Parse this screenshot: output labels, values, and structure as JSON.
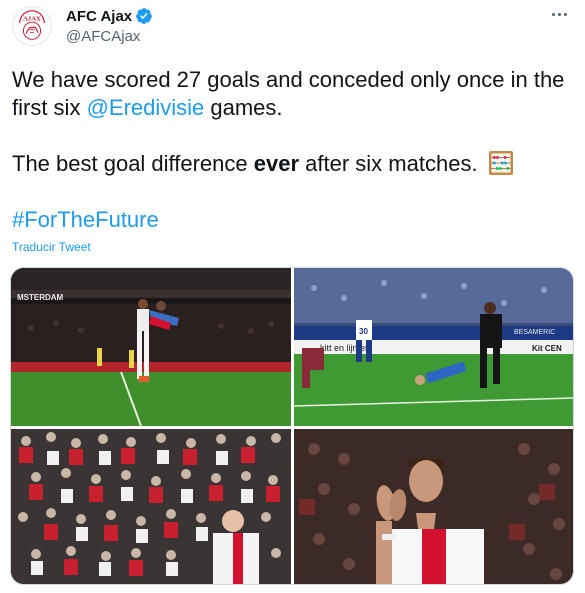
{
  "account": {
    "display_name": "AFC Ajax",
    "handle": "@AFCAjax",
    "avatar_icon": "ajax-crest-icon",
    "verified_icon": "verified-badge-icon",
    "verified_color": "#1d9bf0"
  },
  "tweet": {
    "line1_pre": "We have scored 27 goals and conceded only once in the first six ",
    "mention": "@Eredivisie",
    "line1_post": " games.",
    "line2_pre": "The best goal difference ",
    "line2_bold": "ever",
    "line2_post": " after six matches. ",
    "emoji_icon": "abacus-icon",
    "hashtag": "#ForTheFuture",
    "translate_label": "Traducir Tweet"
  },
  "media": {
    "photos": [
      {
        "icon": "photo-players-celebrating-icon"
      },
      {
        "icon": "photo-player-running-icon"
      },
      {
        "icon": "photo-crowd-icon"
      },
      {
        "icon": "photo-player-applauding-icon"
      }
    ],
    "stadium_banner_1": "MSTERDAM",
    "stadium_banner_2": "kitt  en lijmen",
    "stadium_banner_3": "Kit CEN",
    "stadium_banner_4": "BESAMERIC",
    "shirt_number": "30"
  },
  "colors": {
    "text": "#0f1419",
    "secondary": "#536471",
    "link": "#1d9bf0",
    "ajax_red": "#d2122e"
  }
}
